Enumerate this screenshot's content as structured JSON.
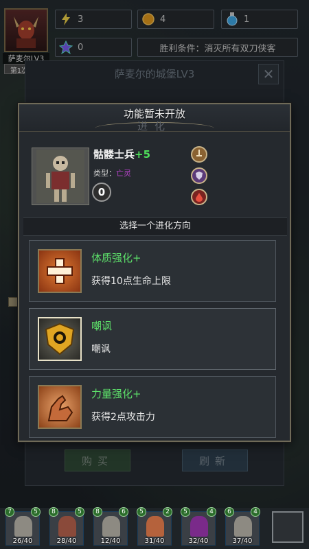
{
  "hud": {
    "hero_name": "萨麦尔LV3",
    "expedition": "第1次征程",
    "energy": "3",
    "gold": "4",
    "potion": "1",
    "crystal": "0",
    "victory_condition": "胜利条件：消灭所有双刀侠客"
  },
  "castle": {
    "title": "萨麦尔的城堡LV3",
    "close_glyph": "✕",
    "buy_label": "购买",
    "refresh_label": "刷新"
  },
  "modal": {
    "toast": "功能暂未开放",
    "ghost_title": "进化",
    "unit": {
      "name": "骷髅士兵",
      "plus": "+5",
      "type_label": "类型：",
      "type_value": "亡灵",
      "badge": "0"
    },
    "choose_prompt": "选择一个进化方向",
    "options": [
      {
        "title": "体质强化+",
        "desc": "获得10点生命上限",
        "icon": "health-cross-icon"
      },
      {
        "title": "嘲讽",
        "desc": "嘲讽",
        "icon": "lion-shield-icon"
      },
      {
        "title": "力量强化+",
        "desc": "获得2点攻击力",
        "icon": "flexed-arm-icon"
      }
    ]
  },
  "army": [
    {
      "hp": "26/40",
      "level_left": "7",
      "level_right": "5"
    },
    {
      "hp": "28/40",
      "level_left": "8",
      "level_right": "5"
    },
    {
      "hp": "12/40",
      "level_left": "8",
      "level_right": "6"
    },
    {
      "hp": "31/40",
      "level_left": "5",
      "level_right": "2"
    },
    {
      "hp": "32/40",
      "level_left": "5",
      "level_right": "4"
    },
    {
      "hp": "37/40",
      "level_left": "6",
      "level_right": "4"
    }
  ],
  "colors": {
    "accent_green": "#5de06a",
    "undead_purple": "#b543c8",
    "frame_gold": "#8a7a55"
  }
}
